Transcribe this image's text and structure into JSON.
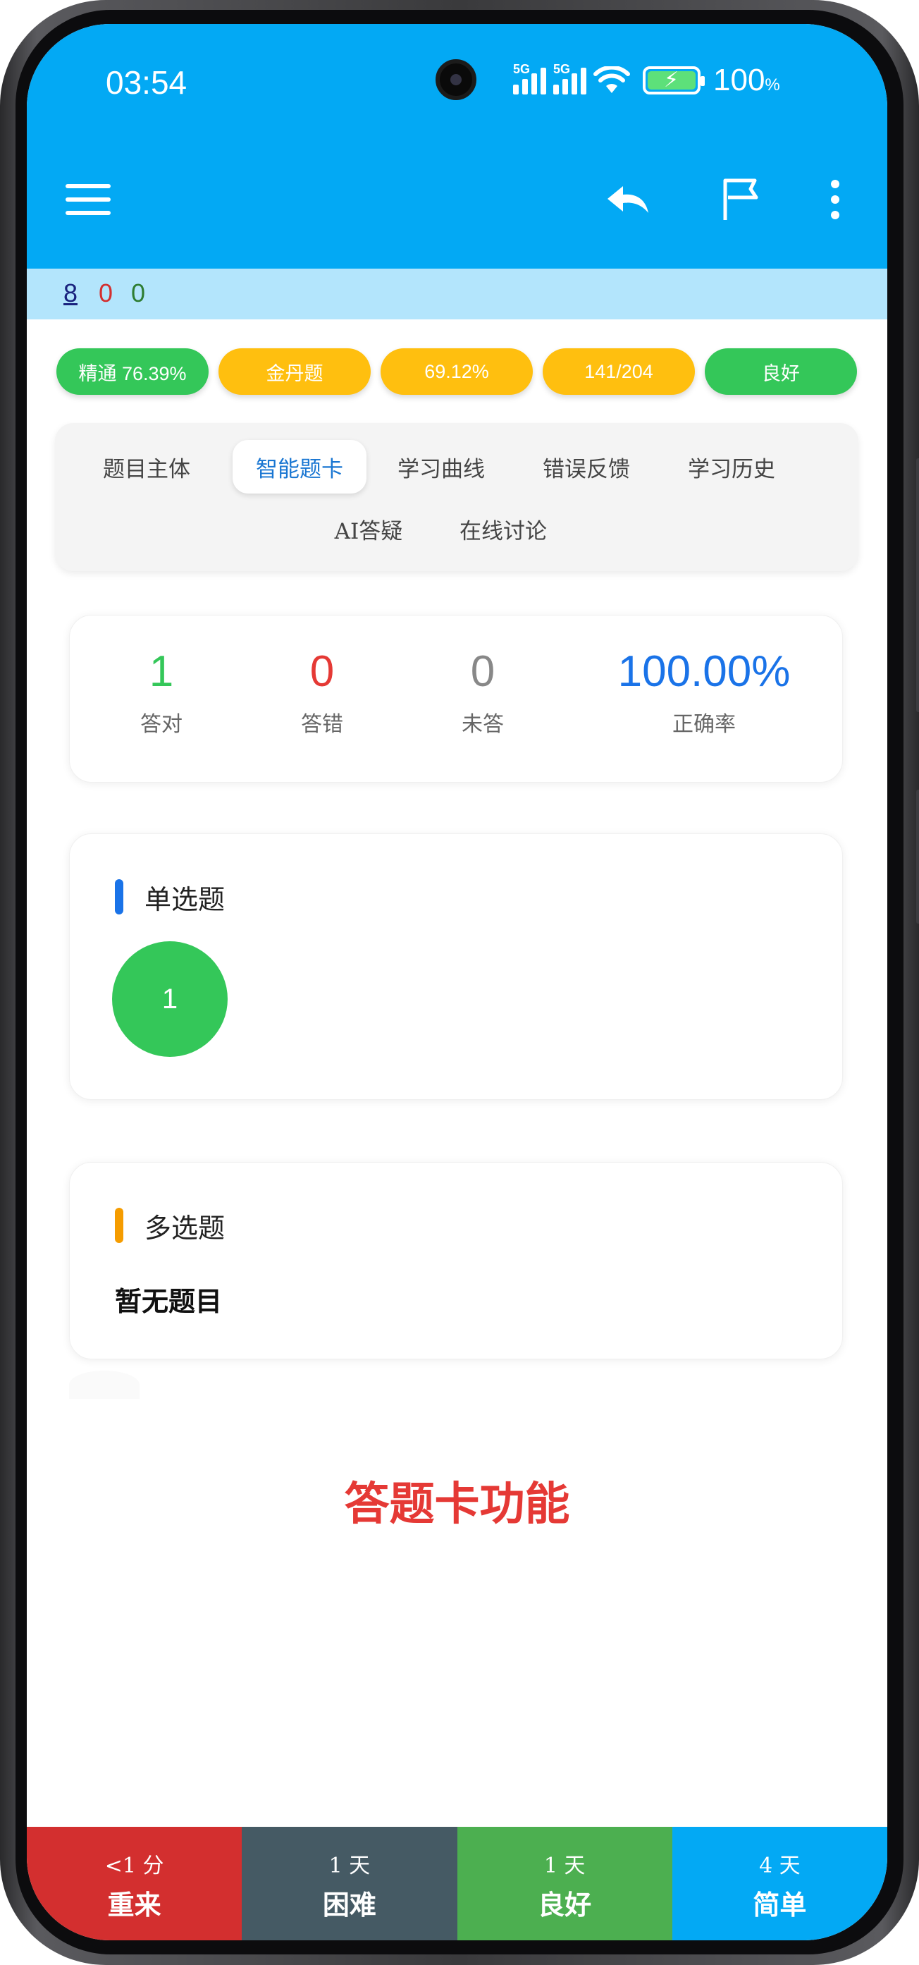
{
  "status_bar": {
    "time": "03:54",
    "network_1": "5G",
    "network_2": "5G",
    "battery_level": "100",
    "battery_unit": "%"
  },
  "counters": {
    "total": "8",
    "wrong": "0",
    "correct": "0"
  },
  "colors": {
    "primary": "#03a9f4",
    "sub_bar": "#b3e5fc",
    "green": "#34c759",
    "amber": "#ffbf0f",
    "red": "#d32f2f",
    "slate": "#455a64",
    "good": "#4caf50",
    "blue_text": "#1976d2"
  },
  "pills": [
    {
      "label": "精通 76.39%",
      "color": "green"
    },
    {
      "label": "金丹题",
      "color": "amber"
    },
    {
      "label": "69.12%",
      "color": "amber"
    },
    {
      "label": "141/204",
      "color": "amber"
    },
    {
      "label": "良好",
      "color": "green"
    }
  ],
  "tabs": [
    {
      "label": "题目主体",
      "active": false
    },
    {
      "label": "智能题卡",
      "active": true
    },
    {
      "label": "学习曲线",
      "active": false
    },
    {
      "label": "错误反馈",
      "active": false
    },
    {
      "label": "学习历史",
      "active": false
    },
    {
      "label": "AI答疑",
      "active": false
    },
    {
      "label": "在线讨论",
      "active": false
    }
  ],
  "stats": [
    {
      "value": "1",
      "label": "答对",
      "color": "#34c759"
    },
    {
      "value": "0",
      "label": "答错",
      "color": "#e53935"
    },
    {
      "value": "0",
      "label": "未答",
      "color": "#888888"
    },
    {
      "value": "100.00%",
      "label": "正确率",
      "color": "#1a73e8"
    }
  ],
  "single_choice": {
    "title": "单选题",
    "questions": [
      "1"
    ]
  },
  "multi_choice": {
    "title": "多选题",
    "empty_text": "暂无题目"
  },
  "caption": "答题卡功能",
  "bottom_buttons": [
    {
      "interval": "<1 分",
      "grade": "重来"
    },
    {
      "interval": "1 天",
      "grade": "困难"
    },
    {
      "interval": "1 天",
      "grade": "良好"
    },
    {
      "interval": "4 天",
      "grade": "简单"
    }
  ],
  "icons": {
    "menu": "menu-icon",
    "undo": "undo-icon",
    "flag": "flag-icon",
    "more": "more-vert-icon"
  }
}
